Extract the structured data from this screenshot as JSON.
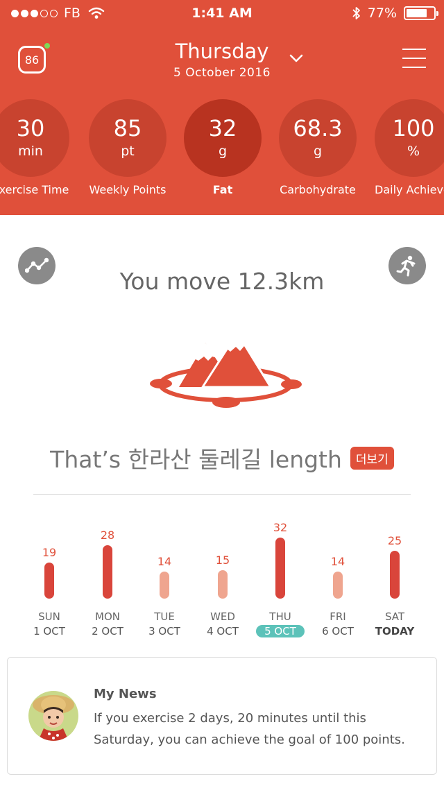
{
  "status_bar": {
    "carrier": "FB",
    "time": "1:41 AM",
    "battery": "77%",
    "battery_level": 0.77,
    "signal_dots_filled": 3,
    "signal_dots_total": 5
  },
  "header": {
    "score": "86",
    "day": "Thursday",
    "date": "5 October 2016",
    "colors": {
      "background": "#e0503a",
      "circle": "#c8432f",
      "selected_circle": "#b83320",
      "online_dot": "#7ed957"
    }
  },
  "metrics": [
    {
      "value": "30",
      "unit": "min",
      "label": "Exercise Time",
      "selected": false
    },
    {
      "value": "85",
      "unit": "pt",
      "label": "Weekly Points",
      "selected": false
    },
    {
      "value": "32",
      "unit": "g",
      "label": "Fat",
      "selected": true
    },
    {
      "value": "68.3",
      "unit": "g",
      "label": "Carbohydrate",
      "selected": false
    },
    {
      "value": "100",
      "unit": "%",
      "label": "Daily Achievement",
      "selected": false
    }
  ],
  "main": {
    "left_icon": "trend-chart-icon",
    "right_icon": "running-person-icon",
    "move_text": "You move 12.3km",
    "illustration": "mountain-illustration",
    "that_text": "That’s 한라산 둘레길 length",
    "more_label": "더보기"
  },
  "weekly": {
    "days": [
      {
        "value": 19,
        "day": "SUN",
        "date": "1 OCT",
        "highlight": true,
        "selected": false,
        "today": false
      },
      {
        "value": 28,
        "day": "MON",
        "date": "2 OCT",
        "highlight": true,
        "selected": false,
        "today": false
      },
      {
        "value": 14,
        "day": "TUE",
        "date": "3 OCT",
        "highlight": false,
        "selected": false,
        "today": false
      },
      {
        "value": 15,
        "day": "WED",
        "date": "4 OCT",
        "highlight": false,
        "selected": false,
        "today": false
      },
      {
        "value": 32,
        "day": "THU",
        "date": "5 OCT",
        "highlight": true,
        "selected": true,
        "today": false
      },
      {
        "value": 14,
        "day": "FRI",
        "date": "6 OCT",
        "highlight": false,
        "selected": false,
        "today": false
      },
      {
        "value": 25,
        "day": "SAT",
        "date": "TODAY",
        "highlight": true,
        "selected": false,
        "today": true
      }
    ],
    "colors": {
      "strong": "#d9453b",
      "light": "#efa58f",
      "selected_date": "#5cc2b9"
    }
  },
  "news": {
    "title": "My News",
    "body": "If you exercise 2 days, 20 minutes until this Saturday, you can achieve the goal of 100 points."
  }
}
